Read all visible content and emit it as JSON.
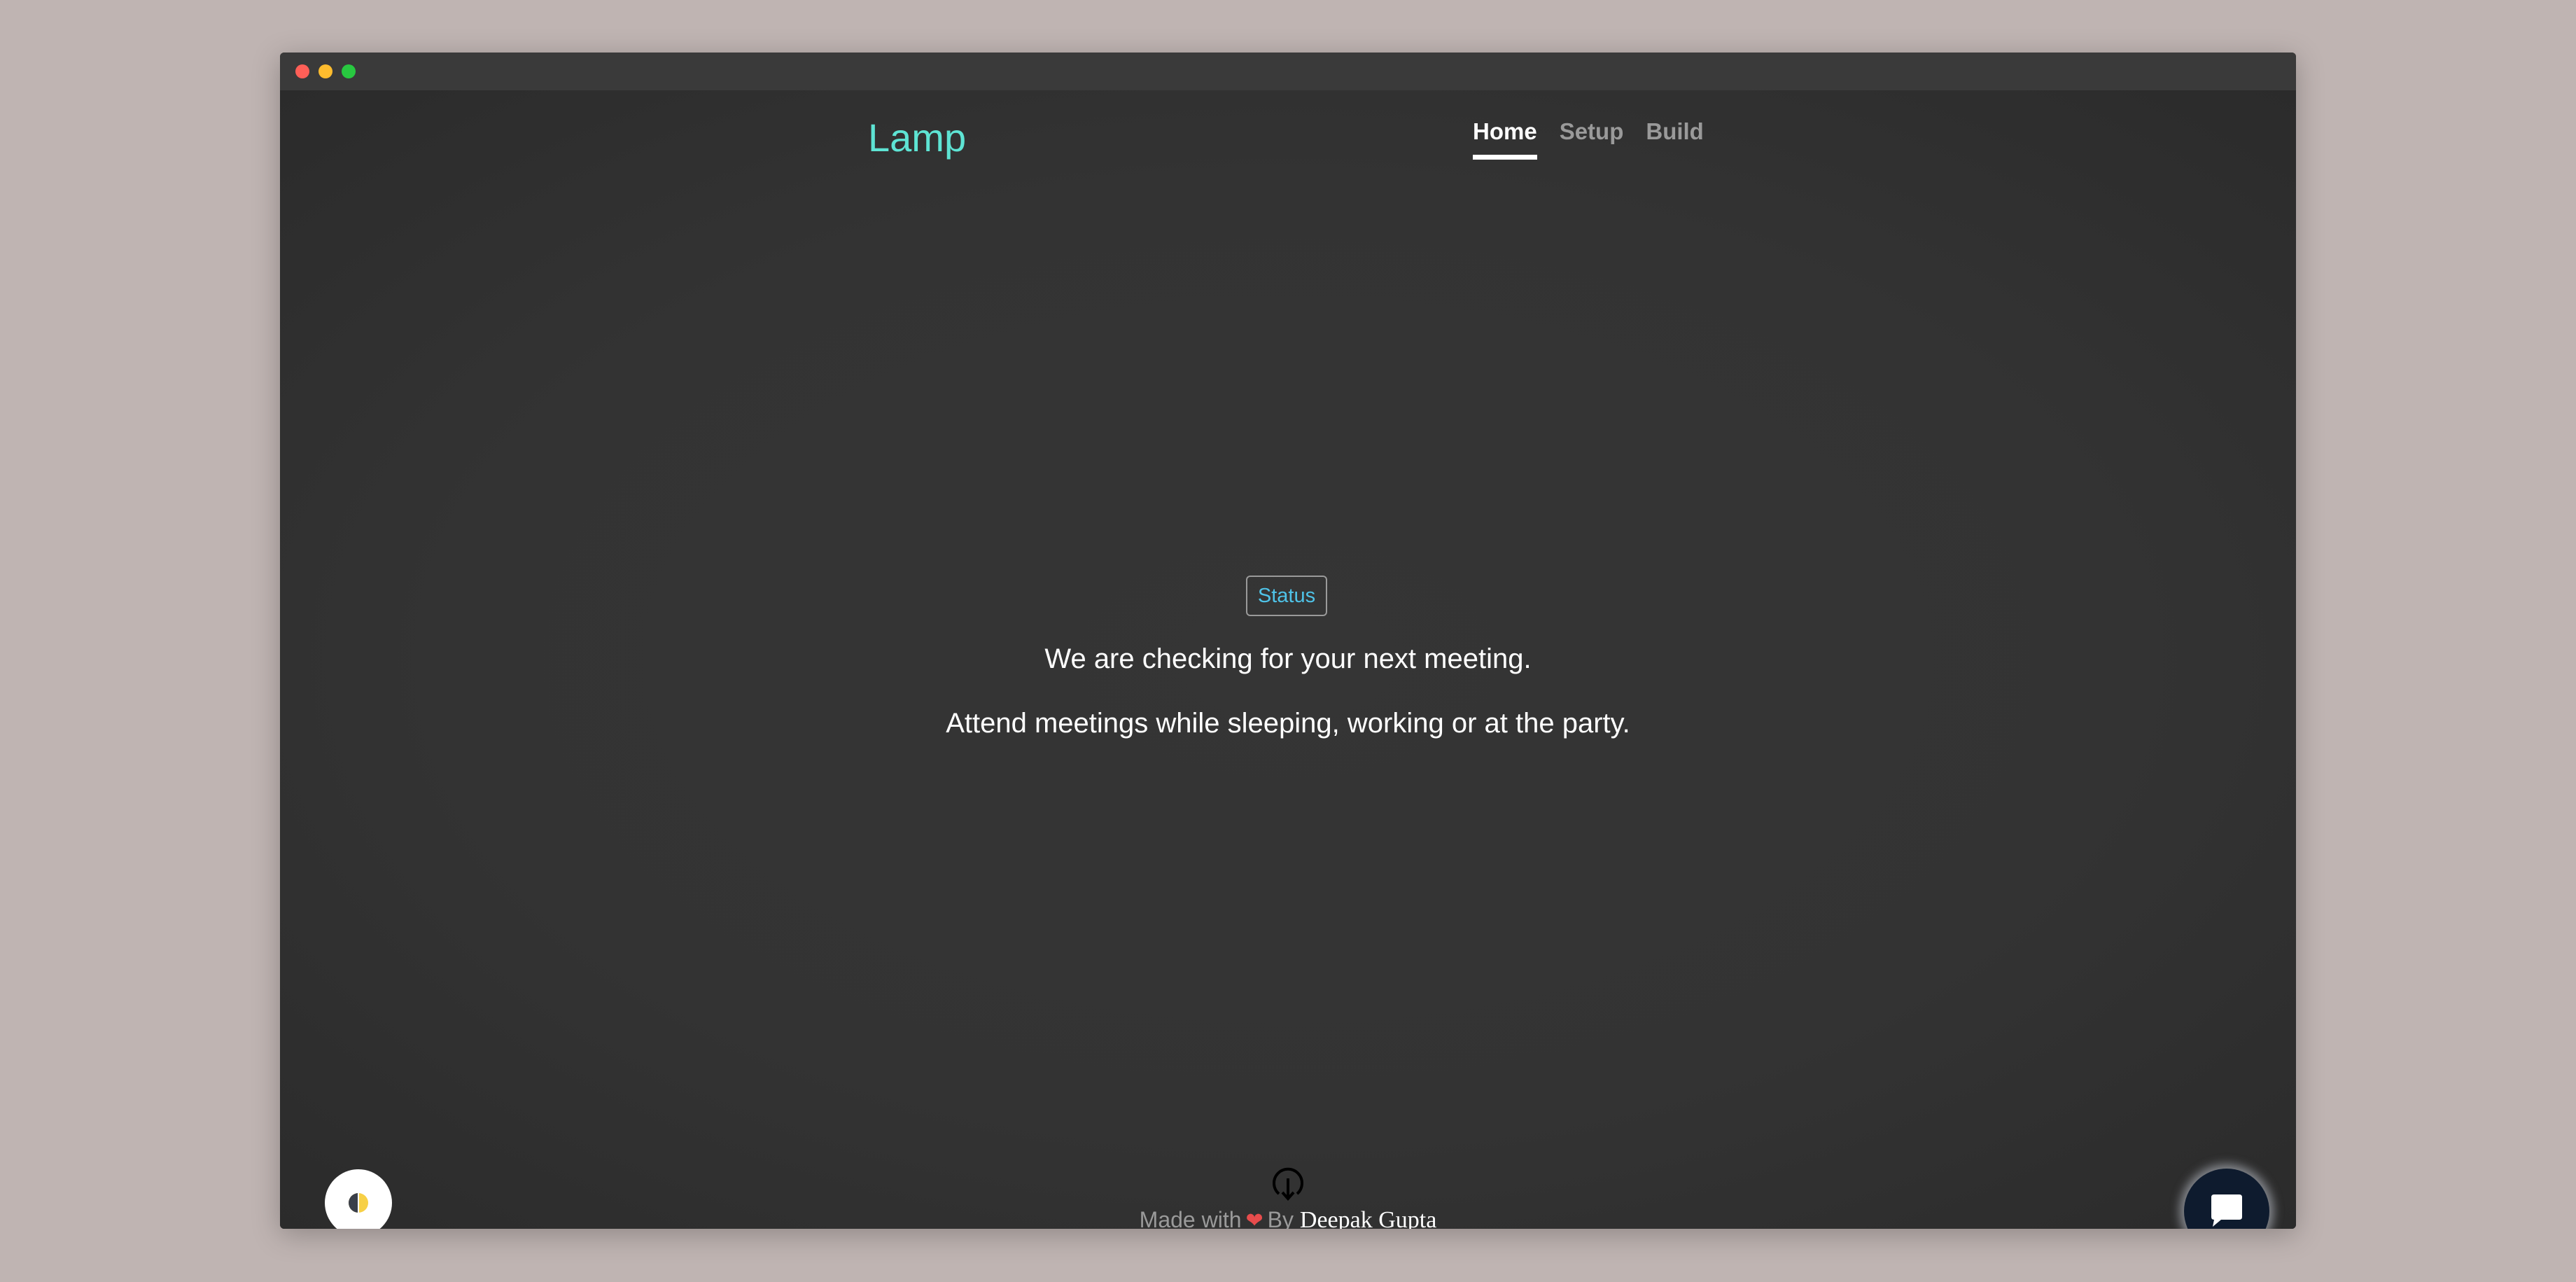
{
  "window": {
    "controls": [
      "close",
      "minimize",
      "maximize"
    ]
  },
  "header": {
    "logo": "Lamp",
    "nav": [
      {
        "label": "Home",
        "active": true
      },
      {
        "label": "Setup",
        "active": false
      },
      {
        "label": "Build",
        "active": false
      }
    ]
  },
  "main": {
    "status_badge": "Status",
    "message_primary": "We are checking for your next meeting.",
    "message_secondary": "Attend meetings while sleeping, working or at the party."
  },
  "footer": {
    "made_with": "Made with",
    "by": "By",
    "author": "Deepak Gupta",
    "icon": "download-arrow-icon"
  },
  "widgets": {
    "theme_toggle_icon": "half-moon-icon",
    "chat_icon": "chat-bubble-icon"
  },
  "colors": {
    "accent": "#5ee4d4",
    "status_text": "#4fc3e8",
    "heart": "#e74c4c",
    "background": "#333333"
  }
}
